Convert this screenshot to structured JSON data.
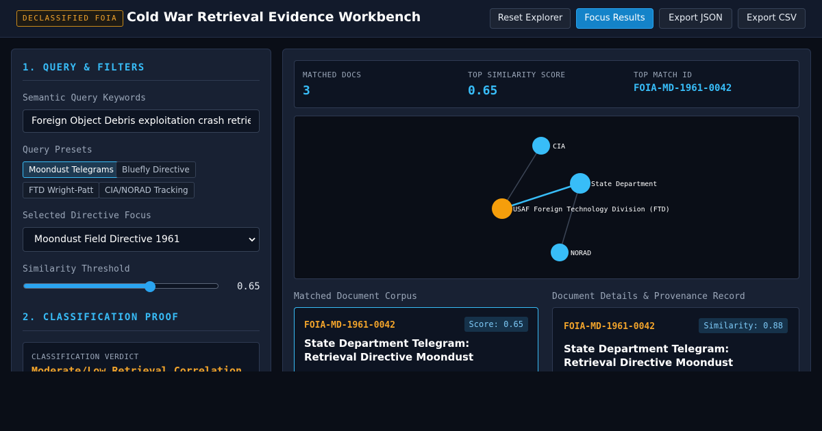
{
  "header": {
    "badge": "DECLASSIFIED FOIA",
    "title": "Cold War Retrieval Evidence Workbench",
    "buttons": {
      "reset": "Reset Explorer",
      "focus": "Focus Results",
      "export_json": "Export JSON",
      "export_csv": "Export CSV"
    }
  },
  "left": {
    "section1_title": "1. QUERY & FILTERS",
    "query_label": "Semantic Query Keywords",
    "query_value": "Foreign Object Debris exploitation crash retrieval",
    "presets_label": "Query Presets",
    "presets": [
      "Moondust Telegrams",
      "Bluefly Directive",
      "FTD Wright-Patt",
      "CIA/NORAD Tracking"
    ],
    "directive_label": "Selected Directive Focus",
    "directive_value": "Moondust Field Directive 1961",
    "threshold_label": "Similarity Threshold",
    "threshold_value": "0.65",
    "threshold_fraction": 0.65,
    "section2_title": "2. CLASSIFICATION PROOF",
    "verdict_label": "CLASSIFICATION VERDICT",
    "verdict_text": "Moderate/Low Retrieval Correlation"
  },
  "stats": {
    "matched_label": "MATCHED DOCS",
    "matched_value": "3",
    "score_label": "TOP SIMILARITY SCORE",
    "score_value": "0.65",
    "topid_label": "TOP MATCH ID",
    "topid_value": "FOIA-MD-1961-0042"
  },
  "graph": {
    "nodes": {
      "cia": "CIA",
      "state": "State Department",
      "ftd": "USAF Foreign Technology Division (FTD)",
      "norad": "NORAD"
    }
  },
  "corpus": {
    "label": "Matched Document Corpus",
    "doc_id": "FOIA-MD-1961-0042",
    "score": "Score: 0.65",
    "title": "State Department Telegram: Retrieval Directive Moondust"
  },
  "details": {
    "label": "Document Details & Provenance Record",
    "doc_id": "FOIA-MD-1961-0042",
    "similarity": "Similarity: 0.88",
    "title": "State Department Telegram: Retrieval Directive Moondust"
  },
  "colors": {
    "accent": "#38bdf8",
    "highlight": "#f2a42b",
    "primary_button": "#1483c9"
  }
}
